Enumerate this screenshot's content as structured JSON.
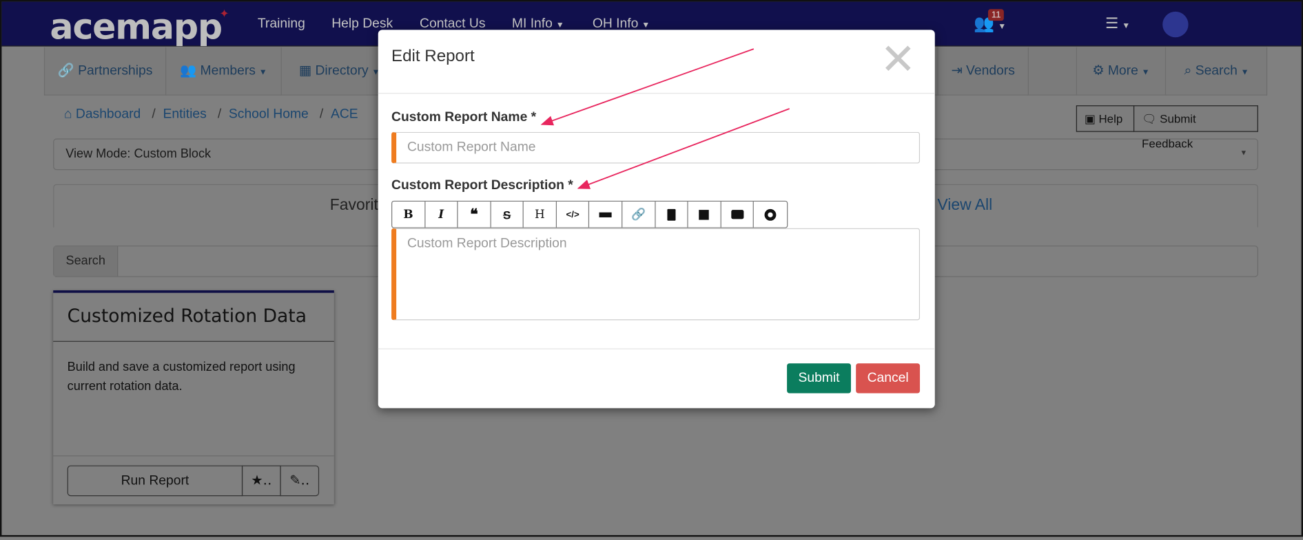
{
  "navbar": {
    "logo": "acemapp",
    "links": [
      {
        "label": "Training"
      },
      {
        "label": "Help Desk"
      },
      {
        "label": "Contact Us"
      },
      {
        "label": "MI Info",
        "caret": true
      },
      {
        "label": "OH Info",
        "caret": true
      }
    ],
    "notification_count": "11"
  },
  "subnav": {
    "items": [
      {
        "label": "Partnerships",
        "icon": "link-icon"
      },
      {
        "label": "Members",
        "icon": "users-icon"
      },
      {
        "label": "Directory",
        "icon": "building-icon"
      },
      {
        "label": "Vendors",
        "icon": "sign-out-icon"
      },
      {
        "label": "More",
        "icon": "gear-icon"
      },
      {
        "label": "Search",
        "icon": "search-icon"
      }
    ]
  },
  "breadcrumb": [
    "Dashboard",
    "Entities",
    "School Home",
    "ACE"
  ],
  "help_label": "Help",
  "feedback_label": "Submit Feedback",
  "view_mode": "View Mode: Custom Block",
  "tabs": {
    "favorites": "Favorites",
    "view_all": "View All"
  },
  "search_label": "Search",
  "card": {
    "title": "Customized Rotation Data",
    "description": "Build and save a customized report using current rotation data.",
    "run_label": "Run Report"
  },
  "modal": {
    "title": "Edit Report",
    "name_label": "Custom Report Name *",
    "name_placeholder": "Custom Report Name",
    "desc_label": "Custom Report Description *",
    "desc_placeholder": "Custom Report Description",
    "toolbar": [
      "bold",
      "italic",
      "quote",
      "strikethrough",
      "heading",
      "code",
      "horizontal-rule",
      "link",
      "upload-file",
      "image",
      "video",
      "preview"
    ],
    "submit_label": "Submit",
    "cancel_label": "Cancel"
  },
  "colors": {
    "navbar": "#11104d",
    "required_accent": "#ef7c1f",
    "submit": "#0b7d5e",
    "cancel": "#d9534f",
    "annotation_arrow": "#e8265e"
  }
}
